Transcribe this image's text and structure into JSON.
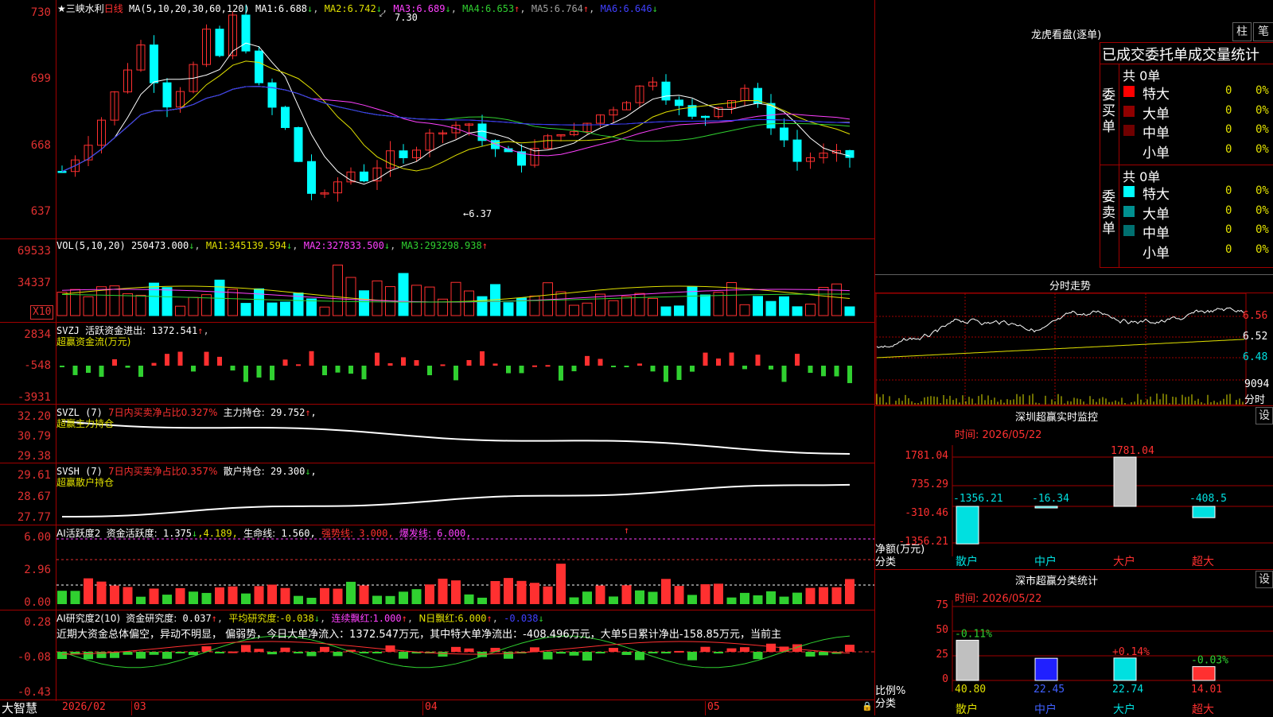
{
  "colors": {
    "up": "#ff3030",
    "down": "#00ffff",
    "grid": "#a00000",
    "white": "#ffffff",
    "yellow": "#e0e000",
    "magenta": "#ff40ff",
    "green": "#30d030",
    "blue": "#4040ff"
  },
  "main": {
    "star": "★",
    "stock_name": "三峡水利",
    "period": "日线",
    "ma_params": "MA(5,10,20,30,60,120)",
    "ma_items": [
      {
        "label": "MA1:",
        "value": "6.688",
        "arrow": "↓"
      },
      {
        "label": "MA2:",
        "value": "6.742",
        "arrow": "↓"
      },
      {
        "label": "MA3:",
        "value": "6.689",
        "arrow": "↓"
      },
      {
        "label": "MA4:",
        "value": "6.653",
        "arrow": "↑"
      },
      {
        "label": "MA5:",
        "value": "6.764",
        "arrow": "↑"
      },
      {
        "label": "MA6:",
        "value": "6.646",
        "arrow": "↓"
      }
    ],
    "y_labels": [
      "730",
      "699",
      "668",
      "637"
    ],
    "high_note": "7.30",
    "low_note": "←6.37",
    "high_arrow": "↙"
  },
  "vol": {
    "title": "VOL(5,10,20)",
    "value": "250473.000",
    "value_arrow": "↓",
    "items": [
      {
        "label": "MA1:",
        "value": "345139.594",
        "arrow": "↓"
      },
      {
        "label": "MA2:",
        "value": "327833.500",
        "arrow": "↓"
      },
      {
        "label": "MA3:",
        "value": "293298.938",
        "arrow": "↑"
      }
    ],
    "y_labels": [
      "69533",
      "34337"
    ],
    "unit": "X10"
  },
  "svzj": {
    "title": "SVZJ",
    "desc": "活跃资金进出:",
    "value": "1372.541",
    "arrow": "↑",
    "sub": "超赢资金流(万元)",
    "y_labels": [
      "2834",
      "-548",
      "-3931"
    ]
  },
  "svzl": {
    "title": "SVZL (7)",
    "ratio_text": "7日内买卖净占比0.327%",
    "hold_label": "主力持仓:",
    "hold_value": "29.752",
    "arrow": "↑",
    "comma": ",",
    "sub": "超赢主力持仓",
    "y_labels": [
      "32.20",
      "30.79",
      "29.38"
    ]
  },
  "svsh": {
    "title": "SVSH (7)",
    "ratio_text": "7日内买卖净占比0.357%",
    "hold_label": "散户持仓:",
    "hold_value": "29.300",
    "arrow": "↓",
    "comma": ",",
    "sub": "超赢散户持仓",
    "y_labels": [
      "29.61",
      "28.67",
      "27.77"
    ]
  },
  "ai_active": {
    "title": "AI活跃度2",
    "label": "资金活跃度:",
    "value": "1.375",
    "arrow": "↓",
    "value2": ",4.189,",
    "life_label": "生命线:",
    "life_value": "1.560,",
    "strong_label": "强势线:",
    "strong_value": "3.000,",
    "burst_label": "爆发线:",
    "burst_value": "6.000,",
    "mark": "↑",
    "y_labels": [
      "6.00",
      "2.96",
      "0.00"
    ]
  },
  "ai_research": {
    "title": "AI研究度2(10)",
    "label": "资金研究度:",
    "value": "0.037",
    "arrow": "↑",
    "avg_label": "平均研究度:",
    "avg_value": "-0.038",
    "avg_arrow": "↓",
    "red_label": "连续飘红:",
    "red_value": "1.000",
    "red_arrow": "↑",
    "nday_label": "N日飘红:",
    "nday_value": "6.000",
    "nday_arrow": "↑",
    "last_value": "-0.038",
    "last_arrow": "↓",
    "comment": "近期大资金总体偏空，异动不明显， 偏弱势，今日大单净流入：1372.547万元，其中特大单净流出：-408.496万元，大单5日累计净出-158.85万元，当前主",
    "y_labels": [
      "0.28",
      "-0.08",
      "-0.43"
    ]
  },
  "bottom": {
    "brand": "大智慧",
    "dates": [
      "2026/02",
      "03",
      "04",
      "05"
    ]
  },
  "dragon": {
    "title": "龙虎看盘(逐单)",
    "btn_zhu": "柱",
    "btn_bi": "笔",
    "header": "已成交委托单成交量统计",
    "buy_label": "委买单",
    "sell_label": "委卖单",
    "buy_total": "共 0单",
    "sell_total": "共 0单",
    "buy_rows": [
      {
        "name": "特大",
        "count": "0",
        "pct": "0%",
        "color": "#ff0000"
      },
      {
        "name": "大单",
        "count": "0",
        "pct": "0%",
        "color": "#900000"
      },
      {
        "name": "中单",
        "count": "0",
        "pct": "0%",
        "color": "#700000"
      },
      {
        "name": "小单",
        "count": "0",
        "pct": "0%",
        "color": ""
      }
    ],
    "sell_rows": [
      {
        "name": "特大",
        "count": "0",
        "pct": "0%",
        "color": "#00ffff"
      },
      {
        "name": "大单",
        "count": "0",
        "pct": "0%",
        "color": "#009090"
      },
      {
        "name": "中单",
        "count": "0",
        "pct": "0%",
        "color": "#007070"
      },
      {
        "name": "小单",
        "count": "0",
        "pct": "0%",
        "color": ""
      }
    ]
  },
  "intraday": {
    "title": "分时走势",
    "y_labels": [
      "6.56",
      "6.52",
      "6.48"
    ],
    "vol_label": "9094",
    "vol_unit": "分时"
  },
  "sz_monitor": {
    "title": "深圳超赢实时监控",
    "btn": "设",
    "time": "时间: 2026/05/22",
    "y_labels": [
      "1781.04",
      "735.29",
      "-310.46",
      "-1356.21"
    ],
    "y_unit": "净额(万元)",
    "x_unit": "分类",
    "categories": [
      "散户",
      "中户",
      "大户",
      "超大"
    ],
    "values": [
      "-1356.21",
      "-16.34",
      "1781.04",
      "-408.5"
    ]
  },
  "sz_class": {
    "title": "深市超赢分类统计",
    "btn": "设",
    "time": "时间: 2026/05/22",
    "y_labels": [
      "75",
      "50",
      "25",
      "0"
    ],
    "y_unit": "比例%",
    "x_unit": "分类",
    "categories": [
      "散户",
      "中户",
      "大户",
      "超大"
    ],
    "values": [
      "40.80",
      "22.45",
      "22.74",
      "14.01"
    ],
    "changes": [
      "-0.11%",
      "",
      "+0.14%",
      "-0.03%"
    ]
  },
  "chart_data": {
    "type": "bar",
    "title": "深圳超赢实时监控",
    "categories": [
      "散户",
      "中户",
      "大户",
      "超大"
    ],
    "series": [
      {
        "name": "净额(万元)",
        "values": [
          -1356.21,
          -16.34,
          1781.04,
          -408.5
        ]
      },
      {
        "name": "比例%",
        "values": [
          40.8,
          22.45,
          22.74,
          14.01
        ]
      }
    ]
  }
}
